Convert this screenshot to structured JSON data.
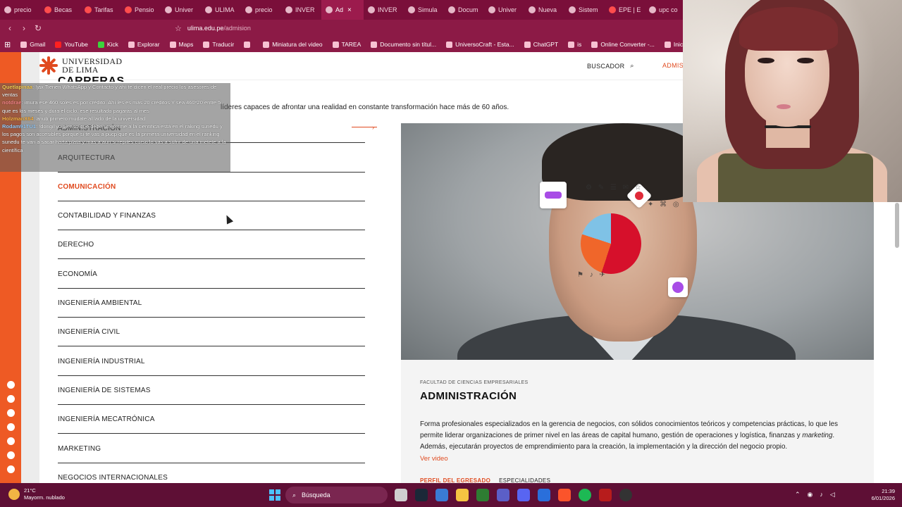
{
  "browser": {
    "tabs": [
      {
        "label": "precio",
        "icon": "google-icon"
      },
      {
        "label": "Becas",
        "icon": "youtube-icon"
      },
      {
        "label": "Tarifas",
        "icon": "youtube-icon"
      },
      {
        "label": "Pensio",
        "icon": "youtube-icon"
      },
      {
        "label": "Univer",
        "icon": "site-icon"
      },
      {
        "label": "ULIMA",
        "icon": "google-icon"
      },
      {
        "label": "precio",
        "icon": "google-icon"
      },
      {
        "label": "INVER",
        "icon": "gear-icon"
      },
      {
        "label": "Ad",
        "icon": "gear-icon",
        "active": true
      },
      {
        "label": "INVER",
        "icon": "gear-icon"
      },
      {
        "label": "Simula",
        "icon": "google-icon"
      },
      {
        "label": "Docum",
        "icon": "docs-icon"
      },
      {
        "label": "Univer",
        "icon": "site-icon"
      },
      {
        "label": "Nueva",
        "icon": "brave-icon"
      },
      {
        "label": "Sistem",
        "icon": "site-icon"
      },
      {
        "label": "EPE | E",
        "icon": "youtube-icon"
      },
      {
        "label": "upc co",
        "icon": "google-icon"
      }
    ],
    "url_domain": "ulima.edu.pe",
    "url_path": "/admision",
    "bookmarks": [
      {
        "label": "Gmail",
        "icon": "gmail-icon"
      },
      {
        "label": "YouTube",
        "icon": "youtube-icon"
      },
      {
        "label": "Kick",
        "icon": "kick-icon"
      },
      {
        "label": "Explorar",
        "icon": "pinterest-icon"
      },
      {
        "label": "Maps",
        "icon": "maps-icon"
      },
      {
        "label": "Traducir",
        "icon": "translate-icon"
      },
      {
        "label": "",
        "icon": "twitch-icon"
      },
      {
        "label": "Miniatura del video",
        "icon": "twitch-icon"
      },
      {
        "label": "TAREA",
        "icon": "tarea-icon"
      },
      {
        "label": "Documento sin títul...",
        "icon": "google-icon"
      },
      {
        "label": "UniversoCraft - Esta...",
        "icon": "site-icon"
      },
      {
        "label": "ChatGPT",
        "icon": "chatgpt-icon"
      },
      {
        "label": "is",
        "icon": "brave-icon"
      },
      {
        "label": "Online Converter -...",
        "icon": "site-icon"
      },
      {
        "label": "Inicia sesión: Cuen",
        "icon": "google-icon"
      }
    ]
  },
  "site": {
    "logo_line1": "UNIVERSIDAD",
    "logo_line2": "DE LIMA",
    "buscador": "BUSCADOR",
    "admision": "ADMISI",
    "section_title": "CARRERAS",
    "intro_tail": "líderes capaces de afrontar una realidad en constante transformación hace más de 60 años.",
    "careers": [
      "ADMINISTRACIÓN",
      "ARQUITECTURA",
      "COMUNICACIÓN",
      "CONTABILIDAD Y FINANZAS",
      "DERECHO",
      "ECONOMÍA",
      "INGENIERÍA AMBIENTAL",
      "INGENIERÍA CIVIL",
      "INGENIERÍA INDUSTRIAL",
      "INGENIERÍA DE SISTEMAS",
      "INGENIERÍA MECATRÓNICA",
      "MARKETING",
      "NEGOCIOS INTERNACIONALES"
    ],
    "active_career": "COMUNICACIÓN",
    "card": {
      "kicker": "FACULTAD DE CIENCIAS EMPRESARIALES",
      "title": "ADMINISTRACIÓN",
      "desc_part1": "Forma profesionales especializados en la gerencia de negocios, con sólidos conocimientos teóricos y competencias prácticas, lo que les permite liderar organizaciones de primer nivel en las áreas de capital humano, gestión de operaciones y logística, finanzas y ",
      "desc_em": "marketing",
      "desc_part2": ". Además, ejecutarán proyectos de emprendimiento para la creación, la implementación y la dirección del negocio propio.",
      "video_link": "Ver video",
      "tab1": "PERFIL DEL EGRESADO",
      "tab2": "ESPECIALIDADES"
    }
  },
  "chat": [
    {
      "user": "Quetlapinaa",
      "text": ": !jax Tienen WhatsApp y Contacto y ahí te dicen el real precio los asesores de ventas"
    },
    {
      "user": "notdrae",
      "text": ": imura ese 460 soles es por crédito. Ahí les es más 20 créditos Y sea 460*20 entre 5 que es los meses y dura el ciclo, ese resultado pagarás al mes"
    },
    {
      "user": "HolzmanX64",
      "text": ": anub primero múdate al lado de la universidad"
    },
    {
      "user": "Rodam91TU1",
      "text": ": !dongil yo pienso que debe smeterme a la científica está en el raking sunedu y los pagos son accesibles porque si te vas a púcp que es la primera universidad en el ranking sunedu te van a sacar harta plata y más a aún si repites curso lo vas a sufrir de una métete a la científica"
    }
  ],
  "taskbar": {
    "temp": "21°C",
    "weather": "Mayorm. nublado",
    "search_placeholder": "Búsqueda",
    "time": "21:39",
    "date": "6/01/2026"
  }
}
